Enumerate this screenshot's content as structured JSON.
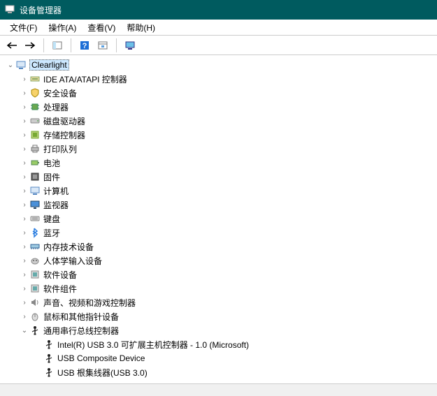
{
  "window": {
    "title": "设备管理器"
  },
  "menu": {
    "file": "文件(F)",
    "action": "操作(A)",
    "view": "查看(V)",
    "help": "帮助(H)"
  },
  "tree": {
    "root": {
      "label": "Clearlight",
      "expanded": true
    },
    "items": [
      {
        "label": "IDE ATA/ATAPI 控制器",
        "icon": "ide"
      },
      {
        "label": "安全设备",
        "icon": "security"
      },
      {
        "label": "处理器",
        "icon": "cpu"
      },
      {
        "label": "磁盘驱动器",
        "icon": "disk"
      },
      {
        "label": "存储控制器",
        "icon": "storage"
      },
      {
        "label": "打印队列",
        "icon": "printer"
      },
      {
        "label": "电池",
        "icon": "battery"
      },
      {
        "label": "固件",
        "icon": "firmware"
      },
      {
        "label": "计算机",
        "icon": "computer"
      },
      {
        "label": "监视器",
        "icon": "monitor"
      },
      {
        "label": "键盘",
        "icon": "keyboard"
      },
      {
        "label": "蓝牙",
        "icon": "bluetooth"
      },
      {
        "label": "内存技术设备",
        "icon": "memory"
      },
      {
        "label": "人体学输入设备",
        "icon": "hid"
      },
      {
        "label": "软件设备",
        "icon": "software"
      },
      {
        "label": "软件组件",
        "icon": "software"
      },
      {
        "label": "声音、视频和游戏控制器",
        "icon": "sound"
      },
      {
        "label": "鼠标和其他指针设备",
        "icon": "mouse"
      },
      {
        "label": "通用串行总线控制器",
        "icon": "usb",
        "expanded": true,
        "children": [
          {
            "label": "Intel(R) USB 3.0 可扩展主机控制器 - 1.0 (Microsoft)"
          },
          {
            "label": "USB Composite Device"
          },
          {
            "label": "USB 根集线器(USB 3.0)"
          }
        ]
      }
    ]
  }
}
